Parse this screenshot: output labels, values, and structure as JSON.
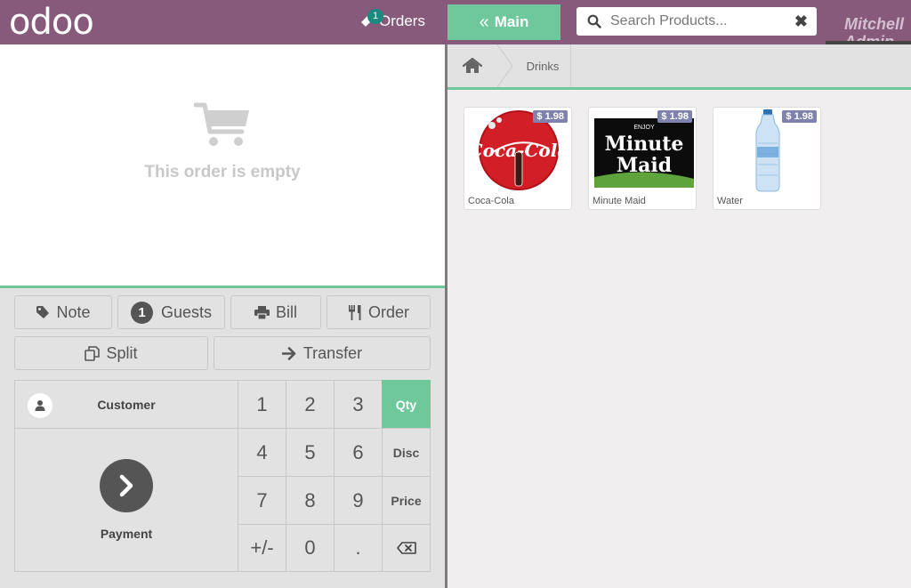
{
  "header": {
    "logo": "odoo",
    "orders_label": "Orders",
    "orders_count": "1",
    "main_label": "Main",
    "search_placeholder": "Search Products...",
    "user_name": "Mitchell Admin"
  },
  "order": {
    "empty_text": "This order is empty"
  },
  "actions": {
    "note": "Note",
    "guests_count": "1",
    "guests": "Guests",
    "bill": "Bill",
    "order": "Order",
    "split": "Split",
    "transfer": "Transfer"
  },
  "numpad": {
    "customer": "Customer",
    "payment": "Payment",
    "keys": [
      "1",
      "2",
      "3",
      "4",
      "5",
      "6",
      "7",
      "8",
      "9",
      "+/-",
      "0",
      "."
    ],
    "modes": [
      "Qty",
      "Disc",
      "Price"
    ],
    "active_mode": "Qty"
  },
  "breadcrumb": {
    "category": "Drinks"
  },
  "products": [
    {
      "name": "Coca-Cola",
      "price": "$ 1.98",
      "icon": "coca-cola-logo"
    },
    {
      "name": "Minute Maid",
      "price": "$ 1.98",
      "icon": "minute-maid-logo"
    },
    {
      "name": "Water",
      "price": "$ 1.98",
      "icon": "water-bottle"
    }
  ],
  "colors": {
    "brand": "#875a7b",
    "accent": "#6ec89b",
    "price_badge": "#7f82ac"
  }
}
